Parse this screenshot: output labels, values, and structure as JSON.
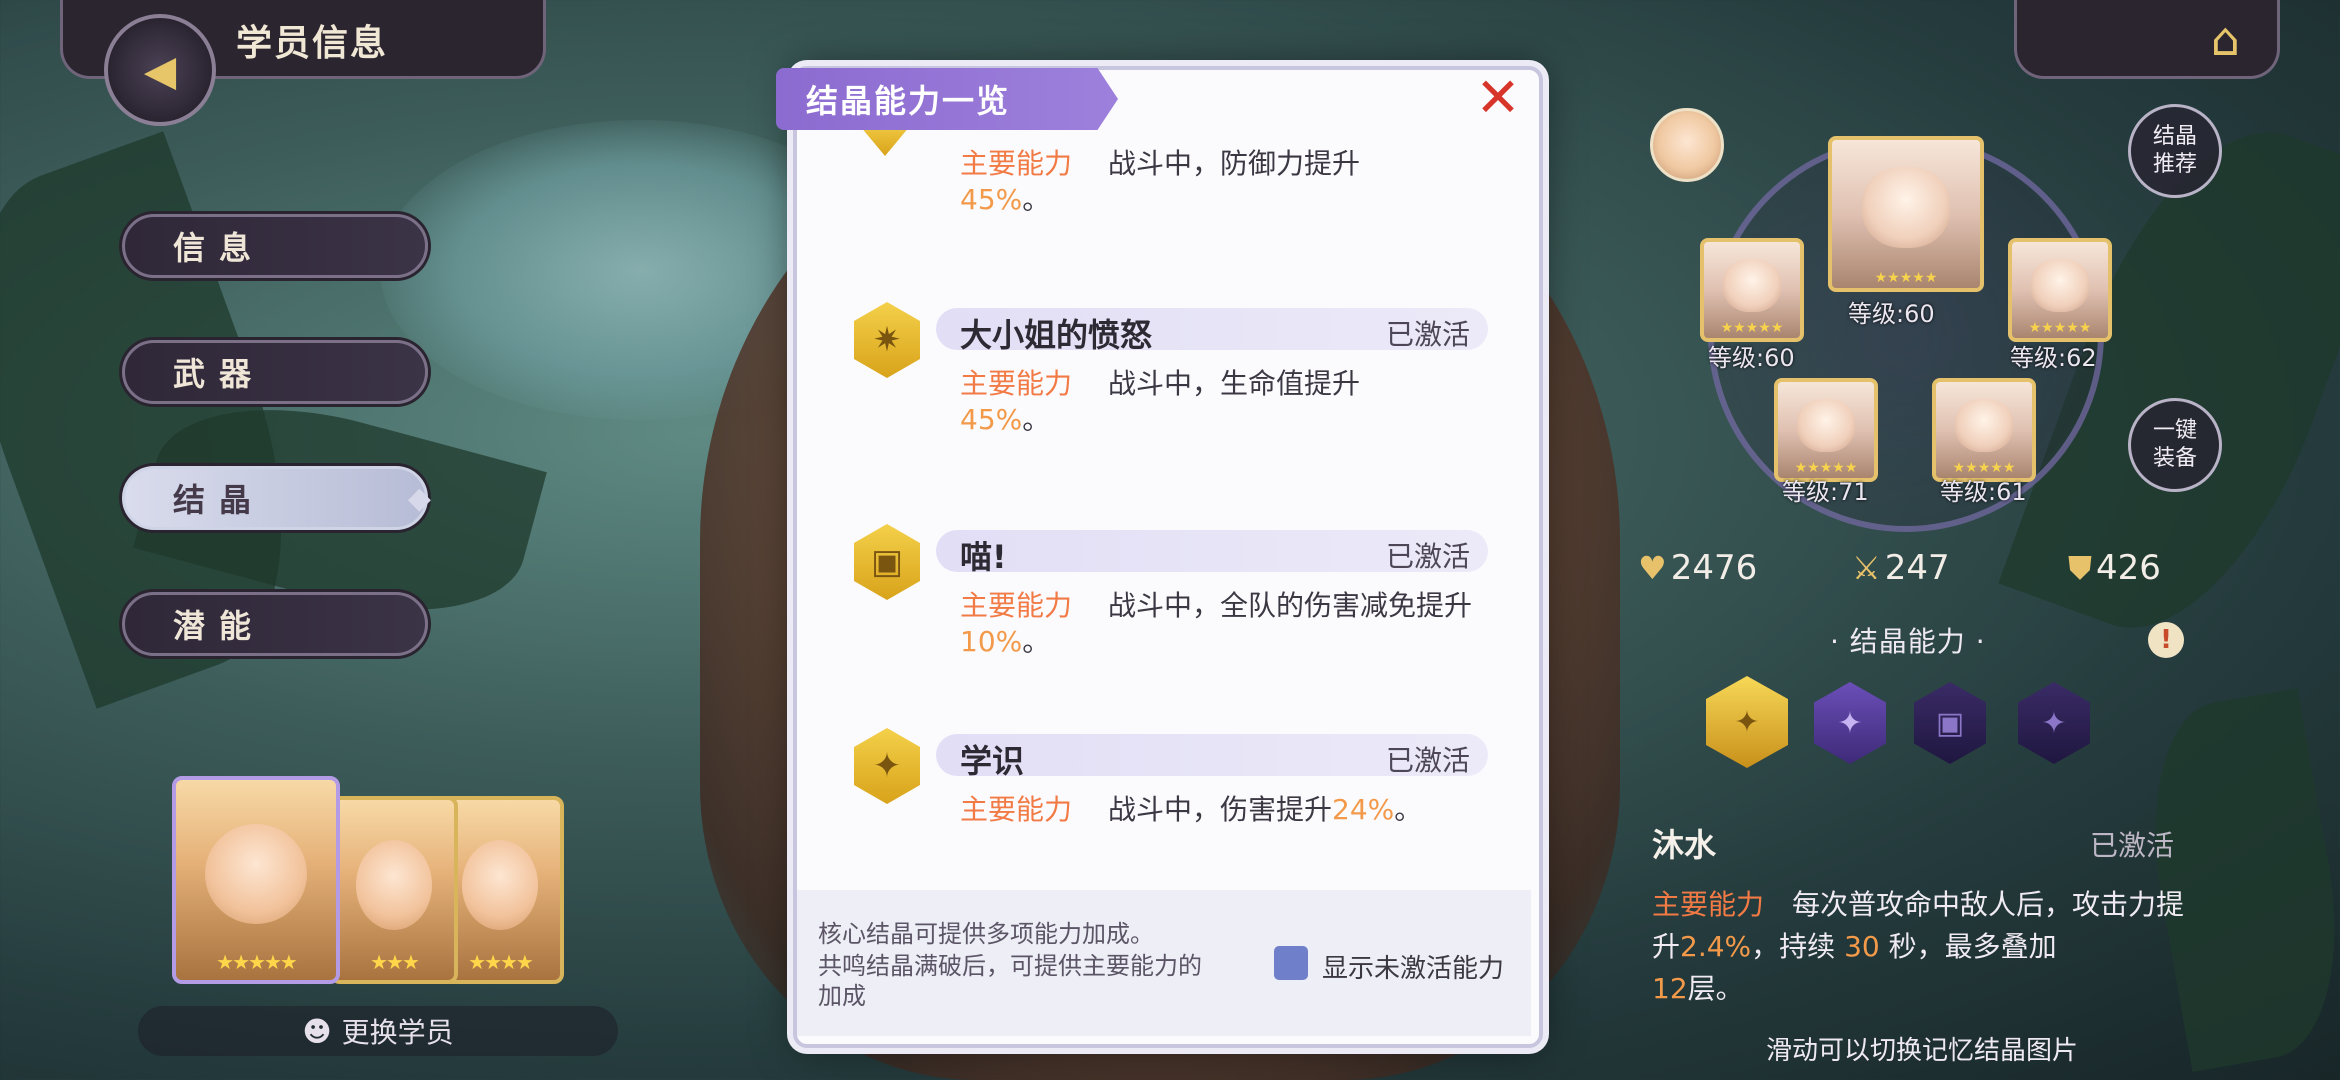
{
  "header": {
    "title": "学员信息"
  },
  "menu": [
    {
      "label": "信息",
      "active": false
    },
    {
      "label": "武器",
      "active": false
    },
    {
      "label": "结晶",
      "active": true
    },
    {
      "label": "潜能",
      "active": false
    }
  ],
  "student_switch": {
    "label": "更换学员"
  },
  "popup": {
    "title": "结晶能力一览",
    "entries": [
      {
        "name": "",
        "status": "",
        "key_label": "主要能力",
        "text": "战斗中，防御力提升",
        "value": "45%",
        "suffix": "。"
      },
      {
        "name": "大小姐的愤怒",
        "status": "已激活",
        "key_label": "主要能力",
        "text": "战斗中，生命值提升",
        "value": "45%",
        "suffix": "。"
      },
      {
        "name": "喵!",
        "status": "已激活",
        "key_label": "主要能力",
        "text": "战斗中，全队的伤害减免提升",
        "value": "10%",
        "suffix": "。"
      },
      {
        "name": "学识",
        "status": "已激活",
        "key_label": "主要能力",
        "text": "战斗中，伤害提升",
        "value": "24%",
        "suffix": "。"
      }
    ],
    "footer": {
      "line1": "核心结晶可提供多项能力加成。",
      "line2": "共鸣结晶满破后，可提供主要能力的",
      "line3": "加成",
      "checkbox_label": "显示未激活能力"
    }
  },
  "right": {
    "recommend_btn": "结晶推荐",
    "equip_btn": "一键装备",
    "center_level": "等级:60",
    "crystal_levels": [
      "等级:60",
      "等级:62",
      "等级:71",
      "等级:61"
    ],
    "stats": {
      "hp": "2476",
      "atk": "247",
      "def": "426"
    },
    "ability_label": "· 结晶能力 ·",
    "warn": "!",
    "detail": {
      "name": "沐水",
      "status": "已激活",
      "key_label": "主要能力",
      "text1": "每次普攻命中敌人后，攻击力提升",
      "v1": "2.4%",
      "text2": "，持续",
      "v2": "30",
      "text3": "秒，最多叠加",
      "v3": "12",
      "text4": "层。"
    },
    "hint": "滑动可以切换记忆结晶图片"
  },
  "colors": {
    "accent_orange": "#f27a45",
    "ribbon_purple": "#8c6bd0",
    "close_red": "#d8352a",
    "gold": "#e8c26a"
  }
}
